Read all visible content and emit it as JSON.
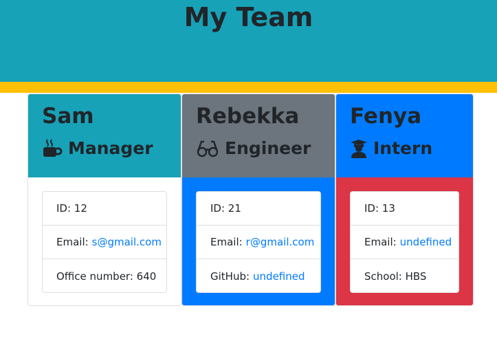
{
  "header": {
    "title": "My Team"
  },
  "colors": {
    "header_bg": "#17a2b8",
    "stripe": "#ffc107",
    "link": "#007bff"
  },
  "cards": [
    {
      "name": "Sam",
      "role": "Manager",
      "icon": "coffee-mug-icon",
      "head_color": "#17a2b8",
      "body_color": "#ffffff",
      "id_label": "ID: 12",
      "email_label": "Email:",
      "email": "s@gmail.com",
      "extra_label": "Office number: 640",
      "extra_link": ""
    },
    {
      "name": "Rebekka",
      "role": "Engineer",
      "icon": "glasses-icon",
      "head_color": "#6c757d",
      "body_color": "#007bff",
      "id_label": "ID: 21",
      "email_label": "Email:",
      "email": "r@gmail.com",
      "extra_label": "GitHub:",
      "extra_link": "undefined"
    },
    {
      "name": "Fenya",
      "role": "Intern",
      "icon": "graduate-icon",
      "head_color": "#007bff",
      "body_color": "#dc3545",
      "id_label": "ID: 13",
      "email_label": "Email:",
      "email": "undefined",
      "extra_label": "School: HBS",
      "extra_link": ""
    }
  ]
}
